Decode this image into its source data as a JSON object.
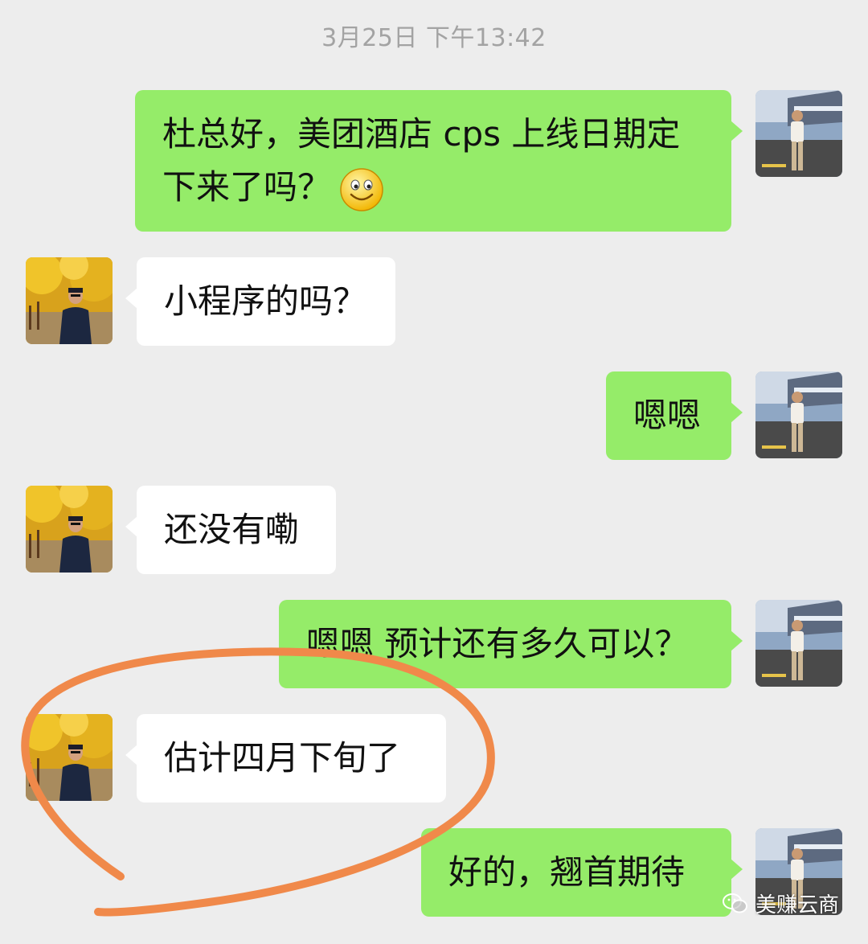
{
  "chat": {
    "timestamp": "3月25日 下午13:42",
    "messages": [
      {
        "sender": "me",
        "text_line1": "杜总好，美团酒店 cps 上线日期定",
        "text_line2": "下来了吗？",
        "emoji": "smiley-icon"
      },
      {
        "sender": "them",
        "text": "小程序的吗？"
      },
      {
        "sender": "me",
        "text": "嗯嗯"
      },
      {
        "sender": "them",
        "text": "还没有嘞"
      },
      {
        "sender": "me",
        "text": "嗯嗯 预计还有多久可以？"
      },
      {
        "sender": "them",
        "text": "估计四月下旬了"
      },
      {
        "sender": "me",
        "text": "好的，翘首期待"
      }
    ]
  },
  "watermark": {
    "text": "美赚云商",
    "icon": "wechat-icon"
  },
  "colors": {
    "background": "#ededed",
    "my_bubble": "#95ec69",
    "their_bubble": "#ffffff",
    "annotation": "#f0894a"
  }
}
